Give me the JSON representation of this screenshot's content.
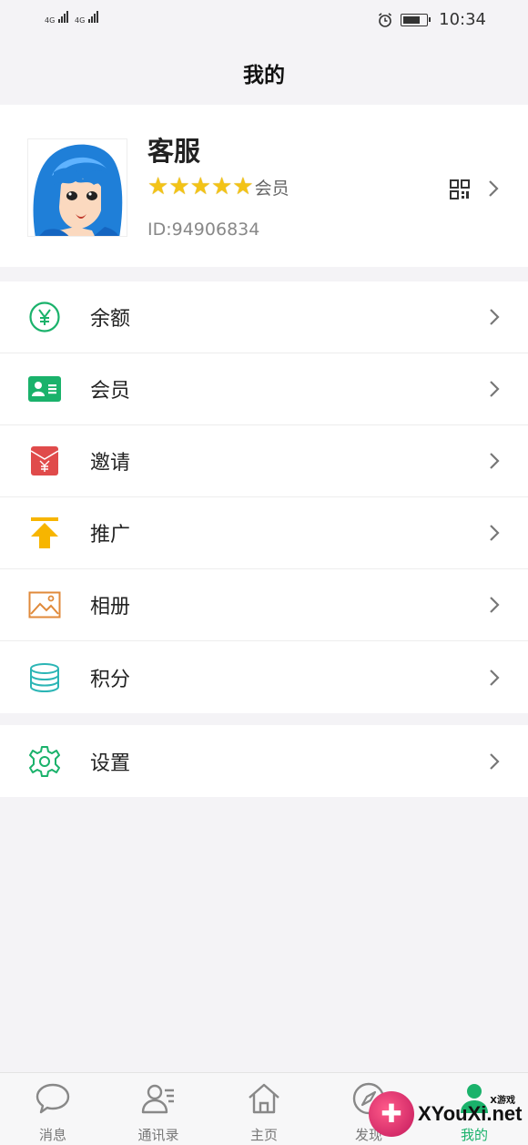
{
  "status_bar": {
    "signal_1": "4G",
    "signal_2": "4G",
    "time": "10:34",
    "icons": [
      "alarm-icon",
      "battery-icon"
    ]
  },
  "title": "我的",
  "profile": {
    "nickname": "客服",
    "rating_stars": 5,
    "member_label": "会员",
    "id_text": "ID:94906834"
  },
  "menu_group_1": [
    {
      "label": "余额",
      "icon": "yuan-icon",
      "color": "#1ab26b"
    },
    {
      "label": "会员",
      "icon": "member-card-icon",
      "color": "#1ab26b"
    },
    {
      "label": "邀请",
      "icon": "red-envelope-icon",
      "color": "#e04b4b"
    },
    {
      "label": "推广",
      "icon": "promote-arrow-icon",
      "color": "#f7b500"
    },
    {
      "label": "相册",
      "icon": "album-icon",
      "color": "#e08a3b"
    },
    {
      "label": "积分",
      "icon": "points-coins-icon",
      "color": "#2bb5b5"
    }
  ],
  "menu_group_2": [
    {
      "label": "设置",
      "icon": "gear-icon",
      "color": "#1ab26b"
    }
  ],
  "tabs": [
    {
      "label": "消息",
      "icon": "chat-bubble-icon"
    },
    {
      "label": "通讯录",
      "icon": "contacts-icon"
    },
    {
      "label": "主页",
      "icon": "home-icon"
    },
    {
      "label": "发现",
      "icon": "compass-icon"
    },
    {
      "label": "我的",
      "icon": "profile-icon"
    }
  ],
  "watermark": {
    "main": "XYouXi.net",
    "small": "X游戏"
  }
}
